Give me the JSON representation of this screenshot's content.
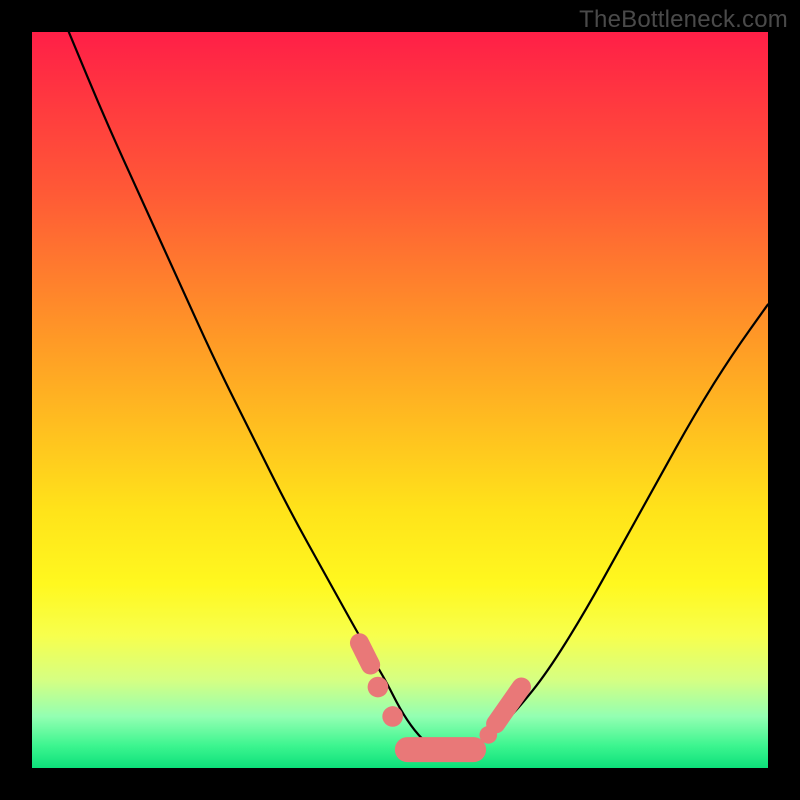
{
  "watermark": "TheBottleneck.com",
  "chart_data": {
    "type": "line",
    "title": "",
    "xlabel": "",
    "ylabel": "",
    "xlim": [
      0,
      100
    ],
    "ylim": [
      0,
      100
    ],
    "series": [
      {
        "name": "curve",
        "x": [
          5,
          10,
          15,
          20,
          25,
          30,
          35,
          40,
          45,
          48,
          50,
          52,
          54,
          56,
          58,
          60,
          63,
          66,
          70,
          75,
          80,
          85,
          90,
          95,
          100
        ],
        "y": [
          100,
          88,
          77,
          66,
          55,
          45,
          35,
          26,
          17,
          12,
          8,
          5,
          3,
          2,
          2,
          3,
          5,
          8,
          13,
          21,
          30,
          39,
          48,
          56,
          63
        ]
      }
    ],
    "markers": [
      {
        "shape": "pill",
        "x1": 51,
        "y1": 2.5,
        "x2": 60,
        "y2": 2.5,
        "thickness": 3.4
      },
      {
        "shape": "circle",
        "cx": 47,
        "cy": 11,
        "r": 1.4
      },
      {
        "shape": "circle",
        "cx": 49,
        "cy": 7,
        "r": 1.4
      },
      {
        "shape": "pill",
        "x1": 44.5,
        "y1": 17,
        "x2": 46,
        "y2": 14,
        "thickness": 2.6
      },
      {
        "shape": "pill",
        "x1": 63,
        "y1": 6,
        "x2": 66.5,
        "y2": 11,
        "thickness": 2.6
      },
      {
        "shape": "circle",
        "cx": 62,
        "cy": 4.5,
        "r": 1.2
      }
    ],
    "marker_color": "#e97878"
  }
}
